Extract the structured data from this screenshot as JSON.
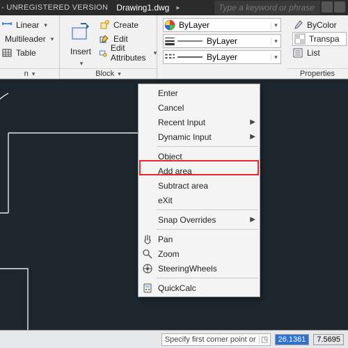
{
  "titlebar": {
    "unregistered": "- UNREGISTERED VERSION",
    "filename": "Drawing1.dwg",
    "search_placeholder": "Type a keyword or phrase"
  },
  "ribbon": {
    "annot": {
      "linear": "Linear",
      "multileader": "Multileader",
      "table": "Table",
      "expand": "n"
    },
    "insert": {
      "label": "Insert",
      "create": "Create",
      "edit": "Edit",
      "edit_attr": "Edit Attributes",
      "panel": "Block"
    },
    "layer": {
      "bylayer": "ByLayer",
      "bylayer2": "ByLayer",
      "bylayer3": "ByLayer"
    },
    "props": {
      "panel": "Properties",
      "bycolor": "ByColor",
      "transparency": "Transpa",
      "list": "List"
    }
  },
  "ctx": {
    "enter": "Enter",
    "cancel": "Cancel",
    "recent": "Recent Input",
    "dynamic": "Dynamic Input",
    "object": "Object",
    "add": "Add area",
    "subtract": "Subtract area",
    "exit": "eXit",
    "snap": "Snap Overrides",
    "pan": "Pan",
    "zoom": "Zoom",
    "wheels": "SteeringWheels",
    "quickcalc": "QuickCalc"
  },
  "status": {
    "prompt": "Specify first corner point or",
    "coord1": "26.1361",
    "coord2": "7.5695"
  }
}
